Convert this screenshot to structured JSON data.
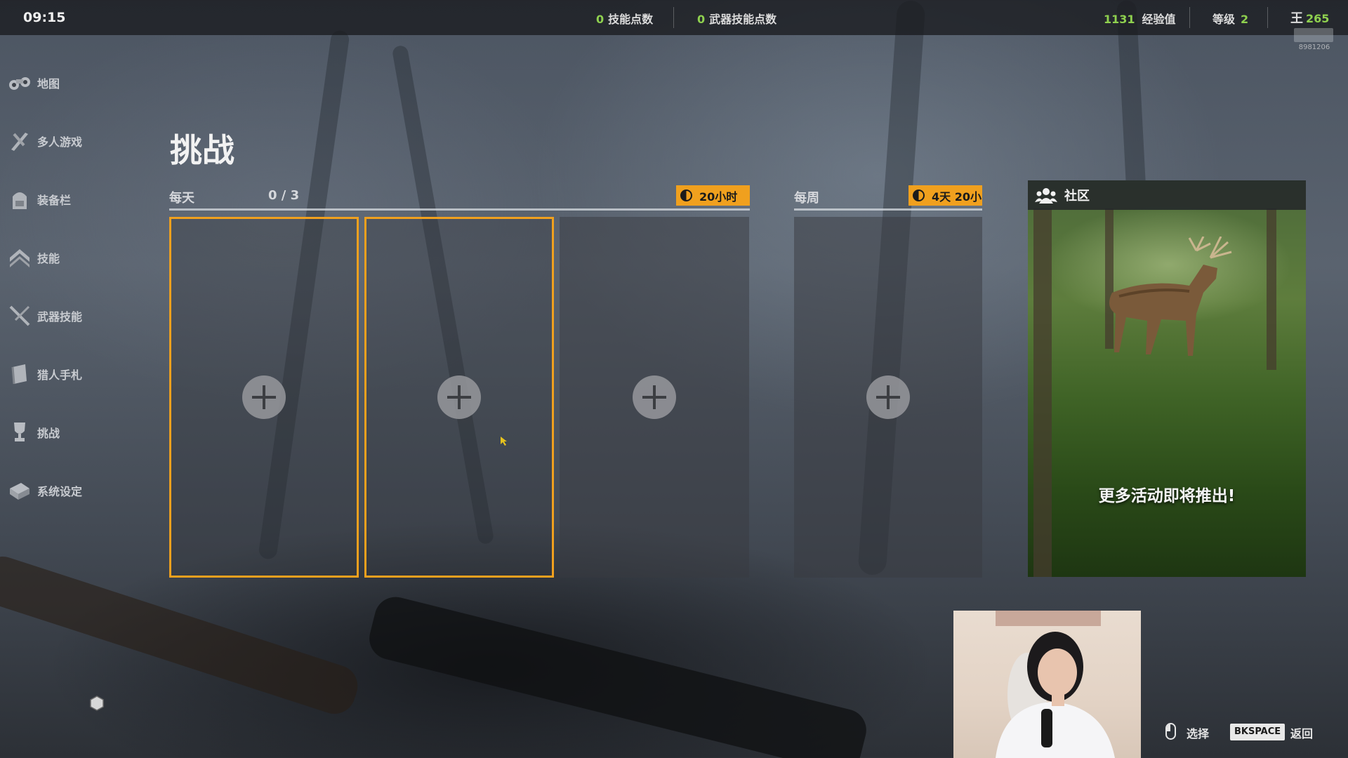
{
  "top_bar": {
    "clock": "09:15",
    "skill_points": {
      "value": "0",
      "label": "技能点数"
    },
    "weapon_skill_points": {
      "value": "0",
      "label": "武器技能点数"
    },
    "experience": {
      "value": "1131",
      "label": "经验值"
    },
    "level": {
      "label": "等级",
      "value": "2"
    },
    "currency": {
      "value": "265"
    },
    "watermark_id": "8981206"
  },
  "sidebar": {
    "items": [
      {
        "label": "地图",
        "icon": "binoculars-icon"
      },
      {
        "label": "多人游戏",
        "icon": "multiplayer-icon"
      },
      {
        "label": "装备栏",
        "icon": "backpack-icon"
      },
      {
        "label": "技能",
        "icon": "rank-chevron-icon"
      },
      {
        "label": "武器技能",
        "icon": "crossed-rifles-icon"
      },
      {
        "label": "猎人手札",
        "icon": "journal-icon"
      },
      {
        "label": "挑战",
        "icon": "trophy-icon"
      },
      {
        "label": "系统设定",
        "icon": "settings-icon"
      }
    ]
  },
  "page": {
    "title": "挑战",
    "daily": {
      "label": "每天",
      "progress": "0 / 3",
      "timer": "20小时"
    },
    "weekly": {
      "label": "每周",
      "timer": "4天 20小"
    },
    "community": {
      "title": "社区",
      "message": "更多活动即将推出!"
    }
  },
  "hints": {
    "select": "选择",
    "back_key": "BKSPACE",
    "back": "返回"
  },
  "colors": {
    "accent": "#f0a01e",
    "green_value": "#8fd14f",
    "top_bar": "#191b1f"
  }
}
